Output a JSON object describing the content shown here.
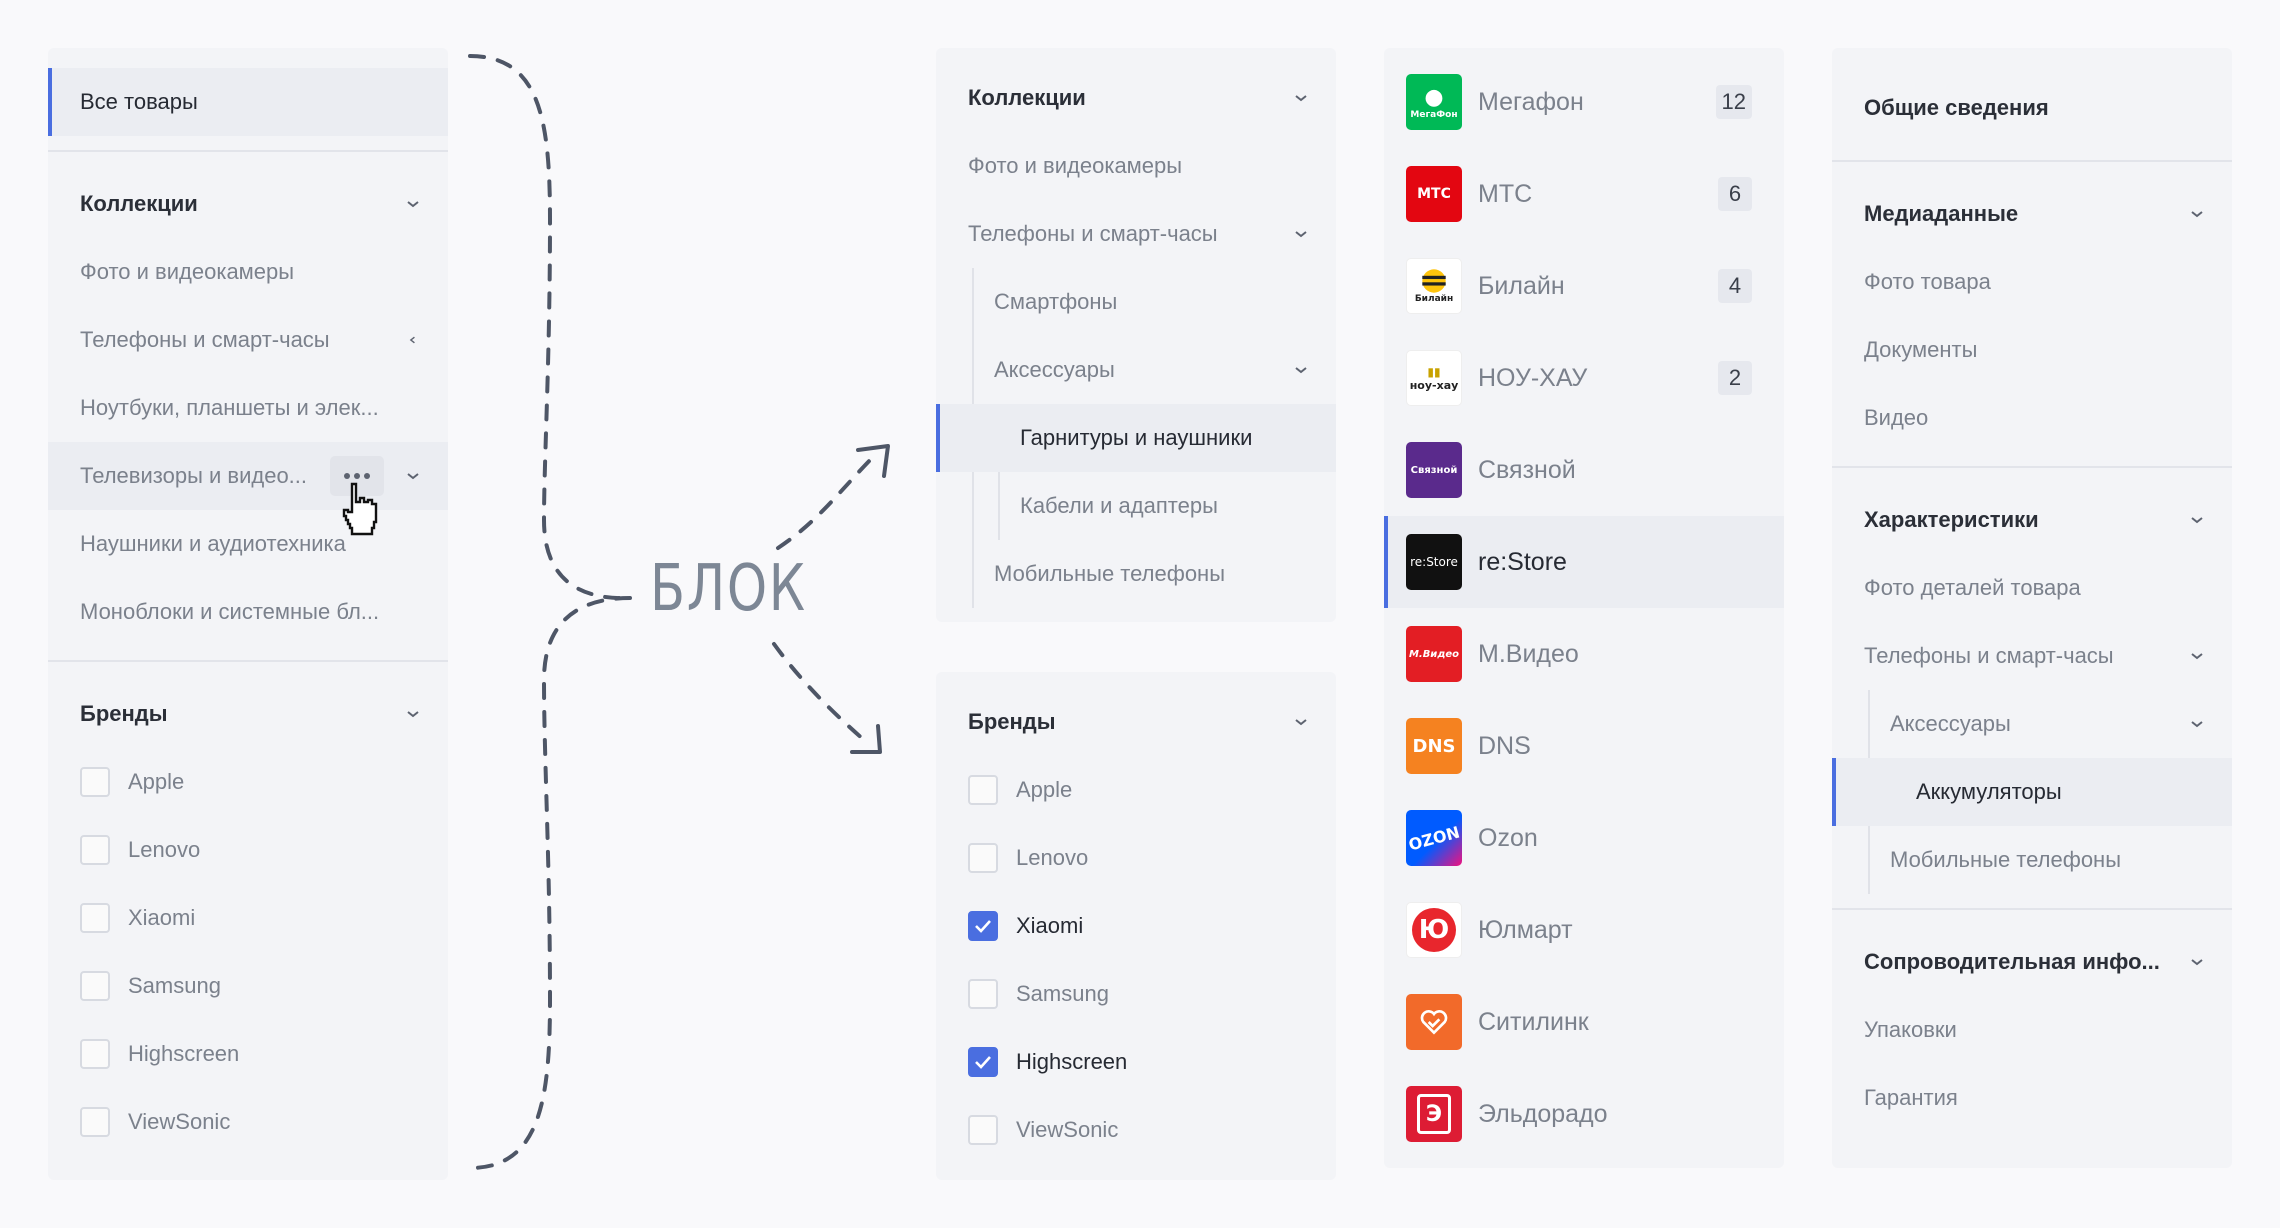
{
  "panel1": {
    "all_label": "Все товары",
    "collections": {
      "title": "Коллекции",
      "items": [
        "Фото и видеокамеры",
        "Телефоны и смарт-часы",
        "Ноутбуки, планшеты и элек...",
        "Телевизоры и видео...",
        "Наушники и аудиотехника",
        "Моноблоки и системные бл..."
      ]
    },
    "brands": {
      "title": "Бренды",
      "items": [
        "Apple",
        "Lenovo",
        "Xiaomi",
        "Samsung",
        "Highscreen",
        "ViewSonic"
      ]
    }
  },
  "annotation": {
    "text": "БЛОК"
  },
  "panel2": {
    "title": "Коллекции",
    "items": [
      "Фото и видеокамеры",
      "Телефоны и смарт-часы"
    ],
    "sub": [
      "Смартфоны",
      "Аксессуары"
    ],
    "subsub": [
      "Гарнитуры и наушники",
      "Кабели и адаптеры"
    ],
    "last": "Мобильные телефоны"
  },
  "panel3": {
    "title": "Бренды",
    "items": [
      {
        "label": "Apple",
        "checked": false
      },
      {
        "label": "Lenovo",
        "checked": false
      },
      {
        "label": "Xiaomi",
        "checked": true
      },
      {
        "label": "Samsung",
        "checked": false
      },
      {
        "label": "Highscreen",
        "checked": true
      },
      {
        "label": "ViewSonic",
        "checked": false
      }
    ]
  },
  "panel4": {
    "shops": [
      {
        "name": "Мегафон",
        "count": "12",
        "color": "#00b956",
        "logo": "МегаФон"
      },
      {
        "name": "МТС",
        "count": "6",
        "color": "#e30611",
        "logo": "МТС"
      },
      {
        "name": "Билайн",
        "count": "4",
        "color": "#ffffff",
        "logo": "Билайн"
      },
      {
        "name": "НОУ-ХАУ",
        "count": "2",
        "color": "#ffffff",
        "logo": "ноу-хау"
      },
      {
        "name": "Связной",
        "count": "",
        "color": "#5a2a8c",
        "logo": "Связной"
      },
      {
        "name": "re:Store",
        "count": "",
        "color": "#111111",
        "logo": "re:Store"
      },
      {
        "name": "М.Видео",
        "count": "",
        "color": "#e31e24",
        "logo": "М.Видео"
      },
      {
        "name": "DNS",
        "count": "",
        "color": "#f58220",
        "logo": "DNS"
      },
      {
        "name": "Ozon",
        "count": "",
        "color": "#005bff",
        "logo": "OZON"
      },
      {
        "name": "Юлмарт",
        "count": "",
        "color": "#ffffff",
        "logo": "Ю"
      },
      {
        "name": "Ситилинк",
        "count": "",
        "color": "#f26a2a",
        "logo": ""
      },
      {
        "name": "Эльдорадо",
        "count": "",
        "color": "#dd1c34",
        "logo": "Э"
      }
    ]
  },
  "panel5": {
    "general": "Общие сведения",
    "media": {
      "title": "Медиаданные",
      "items": [
        "Фото товара",
        "Документы",
        "Видео"
      ]
    },
    "specs": {
      "title": "Характеристики",
      "items": [
        "Фото деталей товара",
        "Телефоны и смарт-часы"
      ],
      "sub": "Аксессуары",
      "subsub": "Аккумуляторы",
      "last": "Мобильные телефоны"
    },
    "accomp": {
      "title": "Сопроводительная инфо...",
      "items": [
        "Упаковки",
        "Гарантия"
      ]
    }
  }
}
